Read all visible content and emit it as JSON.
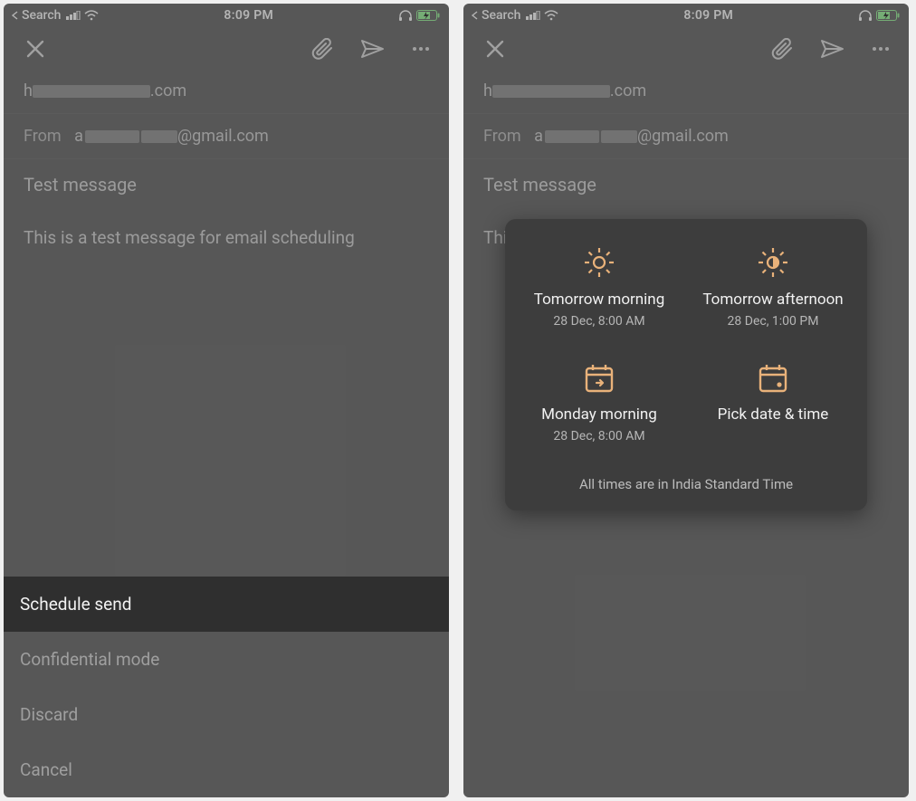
{
  "status": {
    "back_app": "Search",
    "time": "8:09 PM"
  },
  "compose": {
    "to_prefix": "h",
    "to_suffix": ".com",
    "from_label": "From",
    "from_prefix": "a",
    "from_suffix": "@gmail.com",
    "subject": "Test message",
    "body": "This is a test message for email scheduling"
  },
  "sheet": {
    "schedule": "Schedule send",
    "confidential": "Confidential mode",
    "discard": "Discard",
    "cancel": "Cancel"
  },
  "schedule_dialog": {
    "opt1_title": "Tomorrow morning",
    "opt1_sub": "28 Dec, 8:00 AM",
    "opt2_title": "Tomorrow afternoon",
    "opt2_sub": "28 Dec, 1:00 PM",
    "opt3_title": "Monday morning",
    "opt3_sub": "28 Dec, 8:00 AM",
    "opt4_title": "Pick date & time",
    "footer": "All times are in India Standard Time"
  }
}
